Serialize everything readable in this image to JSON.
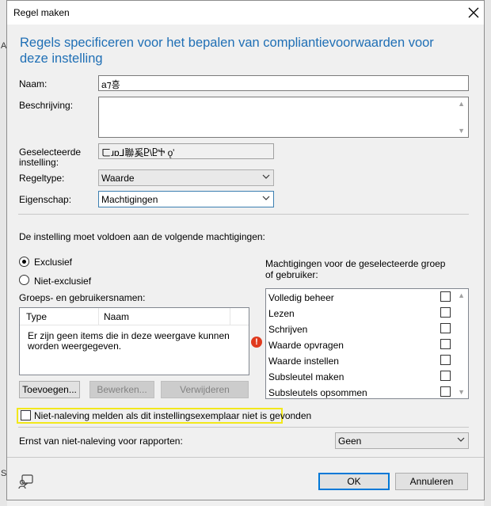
{
  "dialog": {
    "title": "Regel maken",
    "close_icon": "close-icon",
    "heading": "Regels specificeren voor het bepalen van compliantievoorwaarden voor deze instelling"
  },
  "form": {
    "name_label": "Naam:",
    "name_value": "a⁊흥",
    "description_label": "Beschrijving:",
    "description_value": "",
    "selected_setting_label_line1": "Geselecteerde",
    "selected_setting_label_line2": "instelling:",
    "selected_setting_value": "ㄈɹɒ⅃聯奚Ⴒ\\ႲႵ ǫ̛",
    "rule_type_label": "Regeltype:",
    "rule_type_value": "Waarde",
    "property_label": "Eigenschap:",
    "property_value": "Machtigingen"
  },
  "permissions": {
    "intro": "De instelling moet voldoen aan de volgende machtigingen:",
    "exclusive_label": "Exclusief",
    "exclusive_selected": true,
    "non_exclusive_label": "Niet-exclusief",
    "names_label": "Groeps- en gebruikersnamen:",
    "list_columns": [
      "Type",
      "Naam"
    ],
    "empty_message": "Er zijn geen items die in deze weergave kunnen worden weergegeven.",
    "add_button": "Toevoegen...",
    "edit_button": "Bewerken...",
    "remove_button": "Verwijderen",
    "group_perm_label": "Machtigingen voor de geselecteerde groep of gebruiker:",
    "items": [
      {
        "label": "Volledig beheer",
        "checked": false
      },
      {
        "label": "Lezen",
        "checked": false
      },
      {
        "label": "Schrijven",
        "checked": false
      },
      {
        "label": "Waarde opvragen",
        "checked": false
      },
      {
        "label": "Waarde instellen",
        "checked": false
      },
      {
        "label": "Subsleutel maken",
        "checked": false
      },
      {
        "label": "Subsleutels opsommen",
        "checked": false
      }
    ]
  },
  "report": {
    "not_found_label": "Niet-naleving melden als dit instellingsexemplaar niet is gevonden",
    "not_found_checked": false,
    "severity_label": "Ernst van niet-naleving voor rapporten:",
    "severity_value": "Geen"
  },
  "footer": {
    "ok_button": "OK",
    "cancel_button": "Annuleren",
    "help_icon": "help-chat-icon"
  },
  "background": {
    "left_marker": "A",
    "left_bottom_marker": "S"
  },
  "colors": {
    "heading": "#1f6fb5",
    "highlight_border": "#f2e81c",
    "error_icon": "#e03a1e",
    "default_button_border": "#0078d7"
  }
}
